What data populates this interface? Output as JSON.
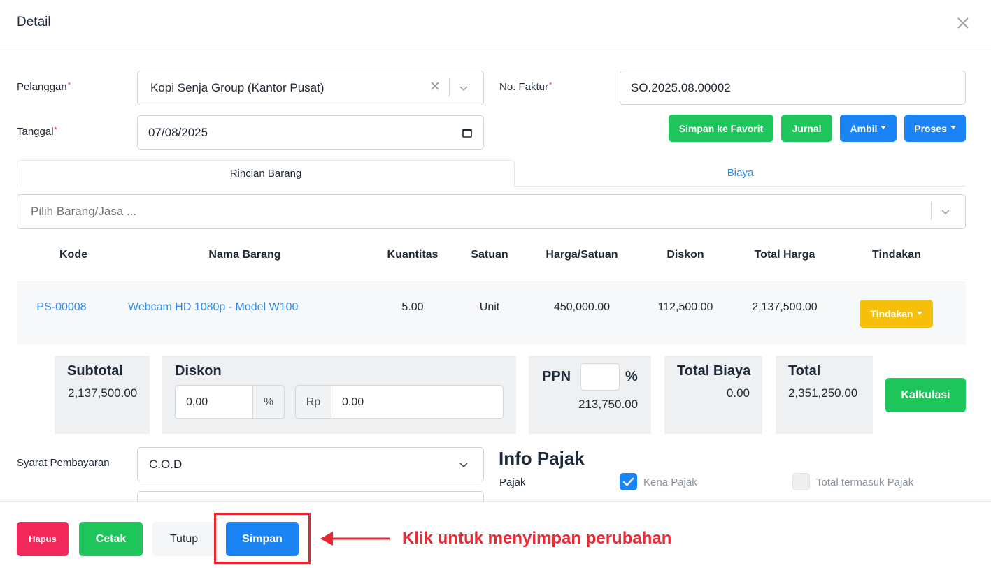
{
  "dialog": {
    "title": "Detail"
  },
  "form": {
    "customer_label": "Pelanggan",
    "customer_value": "Kopi Senja Group (Kantor Pusat)",
    "invoice_label": "No. Faktur",
    "invoice_value": "SO.2025.08.00002",
    "date_label": "Tanggal",
    "date_value": "07/08/2025",
    "required_mark": "*"
  },
  "actions": {
    "favorite": "Simpan ke Favorit",
    "journal": "Jurnal",
    "take": "Ambil",
    "process": "Proses"
  },
  "tabs": {
    "items": "Rincian Barang",
    "costs": "Biaya"
  },
  "item_picker": {
    "placeholder": "Pilih Barang/Jasa ..."
  },
  "table": {
    "headers": [
      "Kode",
      "Nama Barang",
      "Kuantitas",
      "Satuan",
      "Harga/Satuan",
      "Diskon",
      "Total Harga",
      "Tindakan"
    ],
    "rows": [
      {
        "code": "PS-00008",
        "name": "Webcam HD 1080p - Model W100",
        "qty": "5.00",
        "unit": "Unit",
        "price": "450,000.00",
        "discount": "112,500.00",
        "total": "2,137,500.00",
        "action": "Tindakan"
      }
    ]
  },
  "summary": {
    "subtotal_label": "Subtotal",
    "subtotal_value": "2,137,500.00",
    "discount_label": "Diskon",
    "discount_percent": "0,00",
    "percent_sign": "%",
    "currency_label": "Rp",
    "discount_amount": "0.00",
    "ppn_label": "PPN",
    "ppn_percent_sign": "%",
    "ppn_value": "213,750.00",
    "total_cost_label": "Total Biaya",
    "total_cost_value": "0.00",
    "total_label": "Total",
    "total_value": "2,351,250.00",
    "calculate": "Kalkulasi"
  },
  "payment": {
    "label": "Syarat Pembayaran",
    "value": "C.O.D"
  },
  "tax_info": {
    "title": "Info Pajak",
    "tax_label": "Pajak",
    "taxable_label": "Kena Pajak",
    "taxable_checked": true,
    "tax_included_label": "Total termasuk Pajak",
    "tax_included_checked": false
  },
  "footer": {
    "delete": "Hapus",
    "print": "Cetak",
    "close": "Tutup",
    "save": "Simpan",
    "callout": "Klik untuk menyimpan perubahan"
  },
  "colors": {
    "green": "#1ec55a",
    "blue": "#1b84f5",
    "yellow": "#f5bf0a",
    "red": "#f2295a",
    "link": "#2d8cf0",
    "annotation": "#e8262d"
  },
  "icons": [
    "close-icon",
    "clear-icon",
    "chevron-down-icon",
    "calendar-icon",
    "caret-down-icon",
    "check-icon",
    "arrow-left-icon"
  ]
}
